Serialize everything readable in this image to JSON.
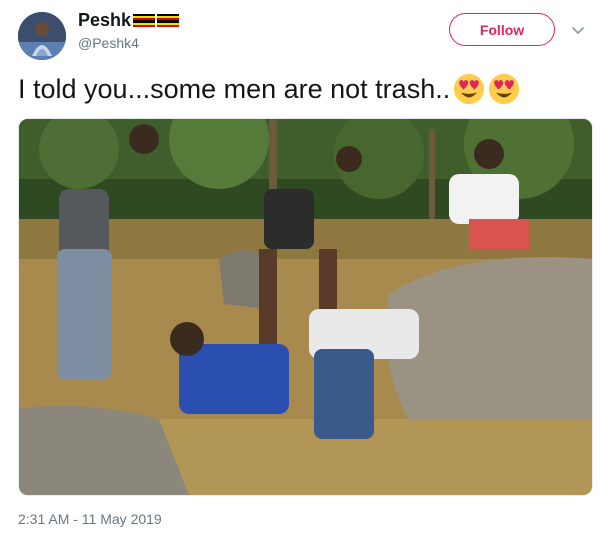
{
  "user": {
    "display_name": "Peshk",
    "handle": "@Peshk4",
    "name_flags": [
      "uganda-flag",
      "uganda-flag"
    ],
    "avatar_icon": "avatar"
  },
  "follow_button": {
    "label": "Follow"
  },
  "menu_icon": "chevron-down-icon",
  "tweet": {
    "text": "I told you...some men are not trash..",
    "emojis": [
      "heart-eyes-emoji",
      "heart-eyes-emoji"
    ]
  },
  "media": {
    "icon": "photo"
  },
  "timestamp": "2:31 AM - 11 May 2019",
  "colors": {
    "accent": "#e0245e",
    "muted": "#657786",
    "text": "#14171a"
  }
}
